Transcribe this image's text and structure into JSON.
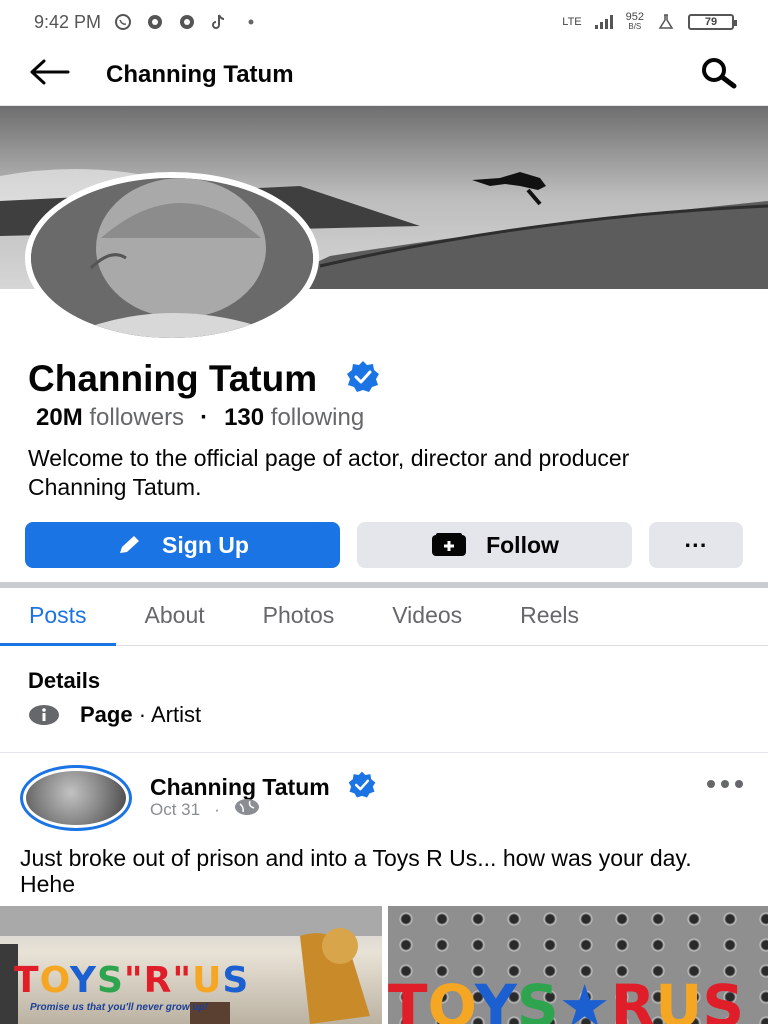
{
  "status_bar": {
    "time": "9:42 PM",
    "network": "LTE",
    "speed_value": "952",
    "speed_unit": "B/S",
    "battery": "79"
  },
  "header": {
    "title": "Channing Tatum",
    "back_icon": "arrow-left-icon",
    "search_icon": "search-icon"
  },
  "profile": {
    "name": "Channing Tatum",
    "followers_count": "20M",
    "followers_label": "followers",
    "separator": "·",
    "following_count": "130",
    "following_label": "following",
    "bio": "Welcome to the official page of actor, director and producer Channing Tatum.",
    "verified_color": "#1b74e4"
  },
  "actions": {
    "signup_label": "Sign Up",
    "follow_label": "Follow",
    "more_label": "···"
  },
  "tabs": [
    {
      "label": "Posts",
      "active": true
    },
    {
      "label": "About",
      "active": false
    },
    {
      "label": "Photos",
      "active": false
    },
    {
      "label": "Videos",
      "active": false
    },
    {
      "label": "Reels",
      "active": false
    }
  ],
  "details": {
    "title": "Details",
    "type_label": "Page",
    "type_sep": "·",
    "category": "Artist"
  },
  "post": {
    "author": "Channing Tatum",
    "date": "Oct 31",
    "meta_sep": "·",
    "text": "Just broke out of prison and into a Toys R Us... how was your day. Hehe",
    "image_left_logo": "TOYS\"R\"US",
    "image_left_caption": "Promise us that you'll never grow up!",
    "image_right_logo": "TOYS R US"
  },
  "colors": {
    "accent": "#1b74e4",
    "muted": "#65676b",
    "button_gray": "#e4e6eb"
  }
}
